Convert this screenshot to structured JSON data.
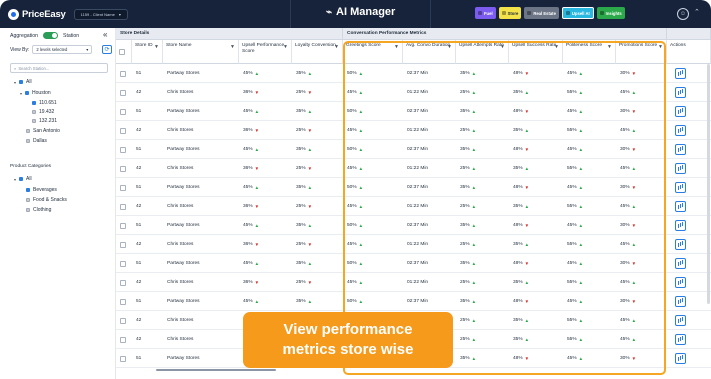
{
  "header": {
    "logo_text": "PriceEasy",
    "client_select": "1159 - Client Name",
    "app_title": "AI Manager",
    "pills": [
      "Fuel",
      "Store",
      "Real Estate",
      "Upsell AI",
      "Insights"
    ],
    "active_pill": "Upsell AI"
  },
  "sidebar": {
    "aggregation_label": "Aggregation",
    "station_label": "Station",
    "view_by_label": "View By:",
    "view_by_value": "2 levels selected",
    "search_placeholder": "Search Station...",
    "tree": {
      "all": "All",
      "houston": "Houston",
      "stations": [
        "110.651",
        "19.432",
        "132.231"
      ],
      "san_antonio": "San Antonio",
      "dallas": "Dallas"
    },
    "categories_title": "Product Categories",
    "categories": {
      "all": "All",
      "items": [
        "Beverages",
        "Food & Snacks",
        "Clothing"
      ]
    }
  },
  "table": {
    "group_store_details": "Store Details",
    "group_conversation": "Conversation Performance Metrics",
    "columns": {
      "store_id": "Store ID",
      "store_name": "Store Name",
      "upsell_perf": "Upsell Performance Score",
      "loyalty": "Loyalty Conversion",
      "greetings": "Greetings Score",
      "avg_convo": "Avg. Convo Duration",
      "upsell_attempts": "Upsell Attempts Rate",
      "upsell_success": "Upsell Success Rate",
      "politeness": "Politeness Score",
      "promotions": "Promotions Score",
      "actions": "Actions"
    },
    "rows": [
      [
        "51",
        "Partway Stores",
        "45%",
        "up",
        "35%",
        "up",
        "50%",
        "up",
        "02:37 Min",
        "35%",
        "up",
        "48%",
        "down",
        "45%",
        "up",
        "30%",
        "down"
      ],
      [
        "42",
        "Chris Stores",
        "36%",
        "down",
        "25%",
        "down",
        "45%",
        "up",
        "01:22 Min",
        "25%",
        "up",
        "35%",
        "up",
        "55%",
        "up",
        "45%",
        "up"
      ],
      [
        "51",
        "Partway Stores",
        "45%",
        "up",
        "35%",
        "up",
        "50%",
        "up",
        "02:37 Min",
        "35%",
        "up",
        "48%",
        "down",
        "45%",
        "up",
        "30%",
        "down"
      ],
      [
        "42",
        "Chris Stores",
        "36%",
        "down",
        "25%",
        "down",
        "45%",
        "up",
        "01:22 Min",
        "25%",
        "up",
        "35%",
        "up",
        "55%",
        "up",
        "45%",
        "up"
      ],
      [
        "51",
        "Partway Stores",
        "45%",
        "up",
        "35%",
        "up",
        "50%",
        "up",
        "02:37 Min",
        "35%",
        "up",
        "48%",
        "down",
        "45%",
        "up",
        "30%",
        "down"
      ],
      [
        "42",
        "Chris Stores",
        "36%",
        "down",
        "25%",
        "down",
        "45%",
        "up",
        "01:22 Min",
        "25%",
        "up",
        "35%",
        "up",
        "55%",
        "up",
        "45%",
        "up"
      ],
      [
        "51",
        "Partway Stores",
        "45%",
        "up",
        "35%",
        "up",
        "50%",
        "up",
        "02:37 Min",
        "35%",
        "up",
        "48%",
        "down",
        "45%",
        "up",
        "30%",
        "down"
      ],
      [
        "42",
        "Chris Stores",
        "36%",
        "down",
        "25%",
        "down",
        "45%",
        "up",
        "01:22 Min",
        "25%",
        "up",
        "35%",
        "up",
        "55%",
        "up",
        "45%",
        "up"
      ],
      [
        "51",
        "Partway Stores",
        "45%",
        "up",
        "35%",
        "up",
        "50%",
        "up",
        "02:37 Min",
        "35%",
        "up",
        "48%",
        "down",
        "45%",
        "up",
        "30%",
        "down"
      ],
      [
        "42",
        "Chris Stores",
        "36%",
        "down",
        "25%",
        "down",
        "45%",
        "up",
        "01:22 Min",
        "25%",
        "up",
        "35%",
        "up",
        "55%",
        "up",
        "45%",
        "up"
      ],
      [
        "51",
        "Partway Stores",
        "45%",
        "up",
        "35%",
        "up",
        "50%",
        "up",
        "02:37 Min",
        "35%",
        "up",
        "48%",
        "down",
        "45%",
        "up",
        "30%",
        "down"
      ],
      [
        "42",
        "Chris Stores",
        "36%",
        "down",
        "25%",
        "down",
        "45%",
        "up",
        "01:22 Min",
        "25%",
        "up",
        "35%",
        "up",
        "55%",
        "up",
        "45%",
        "up"
      ],
      [
        "51",
        "Partway Stores",
        "45%",
        "up",
        "35%",
        "up",
        "50%",
        "up",
        "02:37 Min",
        "35%",
        "up",
        "48%",
        "down",
        "45%",
        "up",
        "30%",
        "down"
      ],
      [
        "42",
        "Chris Stores",
        "36%",
        "down",
        "25%",
        "down",
        "45%",
        "up",
        "01:22 Min",
        "25%",
        "up",
        "35%",
        "up",
        "55%",
        "up",
        "45%",
        "up"
      ],
      [
        "42",
        "Chris Stores",
        "36%",
        "down",
        "25%",
        "down",
        "45%",
        "up",
        "01:22 Min",
        "25%",
        "up",
        "35%",
        "up",
        "55%",
        "up",
        "45%",
        "up"
      ],
      [
        "51",
        "Partway Stores",
        "45%",
        "up",
        "35%",
        "up",
        "50%",
        "up",
        "02:37 Min",
        "35%",
        "up",
        "48%",
        "down",
        "45%",
        "up",
        "30%",
        "down"
      ]
    ]
  },
  "callout": {
    "line1": "View performance",
    "line2": "metrics store wise"
  },
  "colors": {
    "header_bg": "#17233a",
    "accent": "#2a7de1",
    "up": "#2aa84a",
    "down": "#d72e2e",
    "highlight": "#f5a623",
    "callout": "#f59a1b"
  }
}
